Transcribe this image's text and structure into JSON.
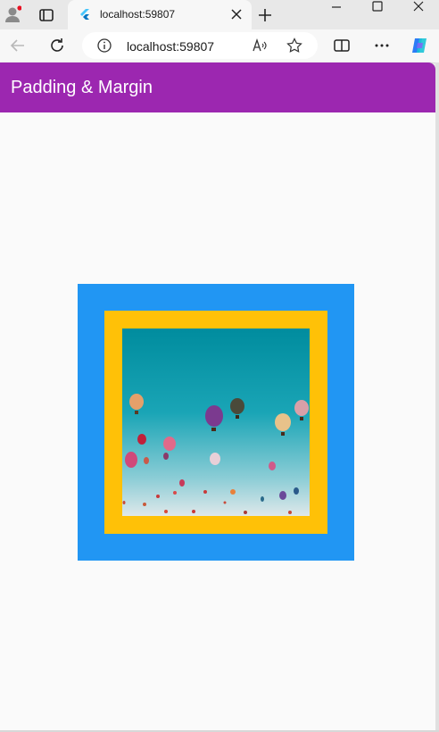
{
  "browser": {
    "tab_title": "localhost:59807",
    "address": "localhost:59807"
  },
  "app": {
    "title": "Padding & Margin",
    "colors": {
      "appbar": "#9c27b0",
      "outer_box": "#2196f3",
      "inner_box": "#ffc107",
      "background": "#fafafa"
    },
    "image": {
      "subject": "hot air balloons in blue sky"
    }
  },
  "icons": {
    "profile": "profile-icon",
    "tabs": "tab-actions-icon",
    "favicon": "flutter-favicon-icon",
    "close": "close-icon",
    "new_tab": "plus-icon",
    "back": "back-arrow-icon",
    "refresh": "refresh-icon",
    "info": "info-icon",
    "read_aloud": "read-aloud-icon",
    "favorite": "star-icon",
    "split": "split-screen-icon",
    "more": "more-icon",
    "copilot": "copilot-icon"
  }
}
